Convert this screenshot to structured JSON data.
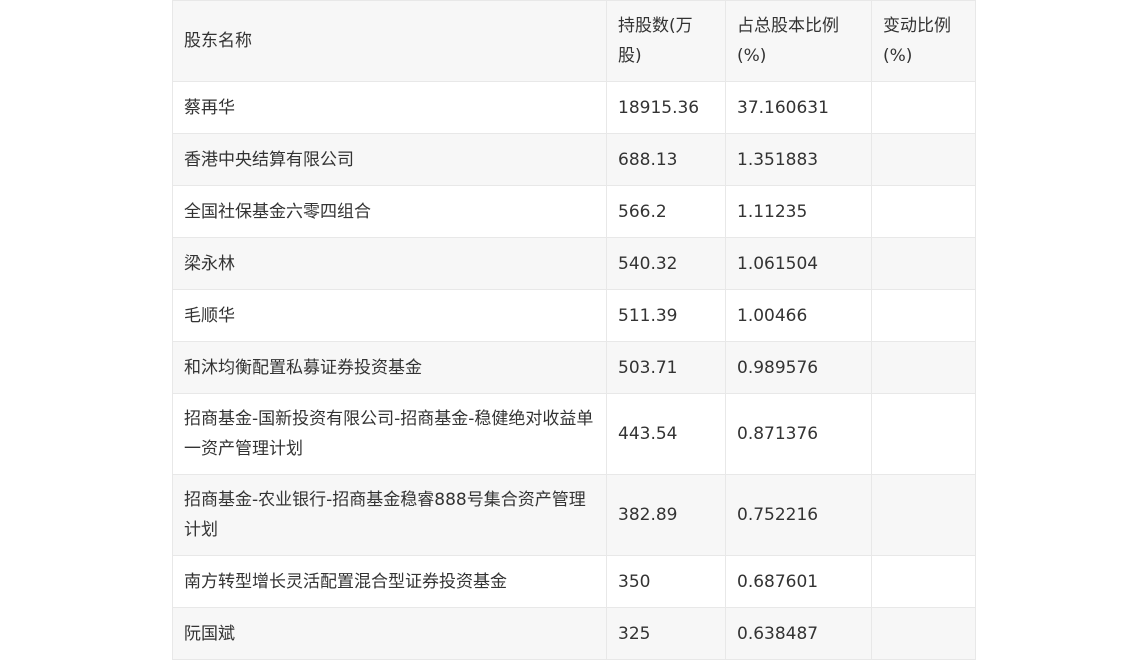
{
  "table": {
    "headers": [
      "股东名称",
      "持股数(万股)",
      "占总股本比例(%)",
      "变动比例(%)"
    ],
    "rows": [
      {
        "name": "蔡再华",
        "shares": "18915.36",
        "ratio": "37.160631",
        "change": ""
      },
      {
        "name": "香港中央结算有限公司",
        "shares": "688.13",
        "ratio": "1.351883",
        "change": ""
      },
      {
        "name": "全国社保基金六零四组合",
        "shares": "566.2",
        "ratio": "1.11235",
        "change": ""
      },
      {
        "name": "梁永林",
        "shares": "540.32",
        "ratio": "1.061504",
        "change": ""
      },
      {
        "name": "毛顺华",
        "shares": "511.39",
        "ratio": "1.00466",
        "change": ""
      },
      {
        "name": "和沐均衡配置私募证券投资基金",
        "shares": "503.71",
        "ratio": "0.989576",
        "change": ""
      },
      {
        "name": "招商基金-国新投资有限公司-招商基金-稳健绝对收益单一资产管理计划",
        "shares": "443.54",
        "ratio": "0.871376",
        "change": ""
      },
      {
        "name": "招商基金-农业银行-招商基金稳睿888号集合资产管理计划",
        "shares": "382.89",
        "ratio": "0.752216",
        "change": ""
      },
      {
        "name": "南方转型增长灵活配置混合型证券投资基金",
        "shares": "350",
        "ratio": "0.687601",
        "change": ""
      },
      {
        "name": "阮国斌",
        "shares": "325",
        "ratio": "0.638487",
        "change": ""
      }
    ]
  }
}
